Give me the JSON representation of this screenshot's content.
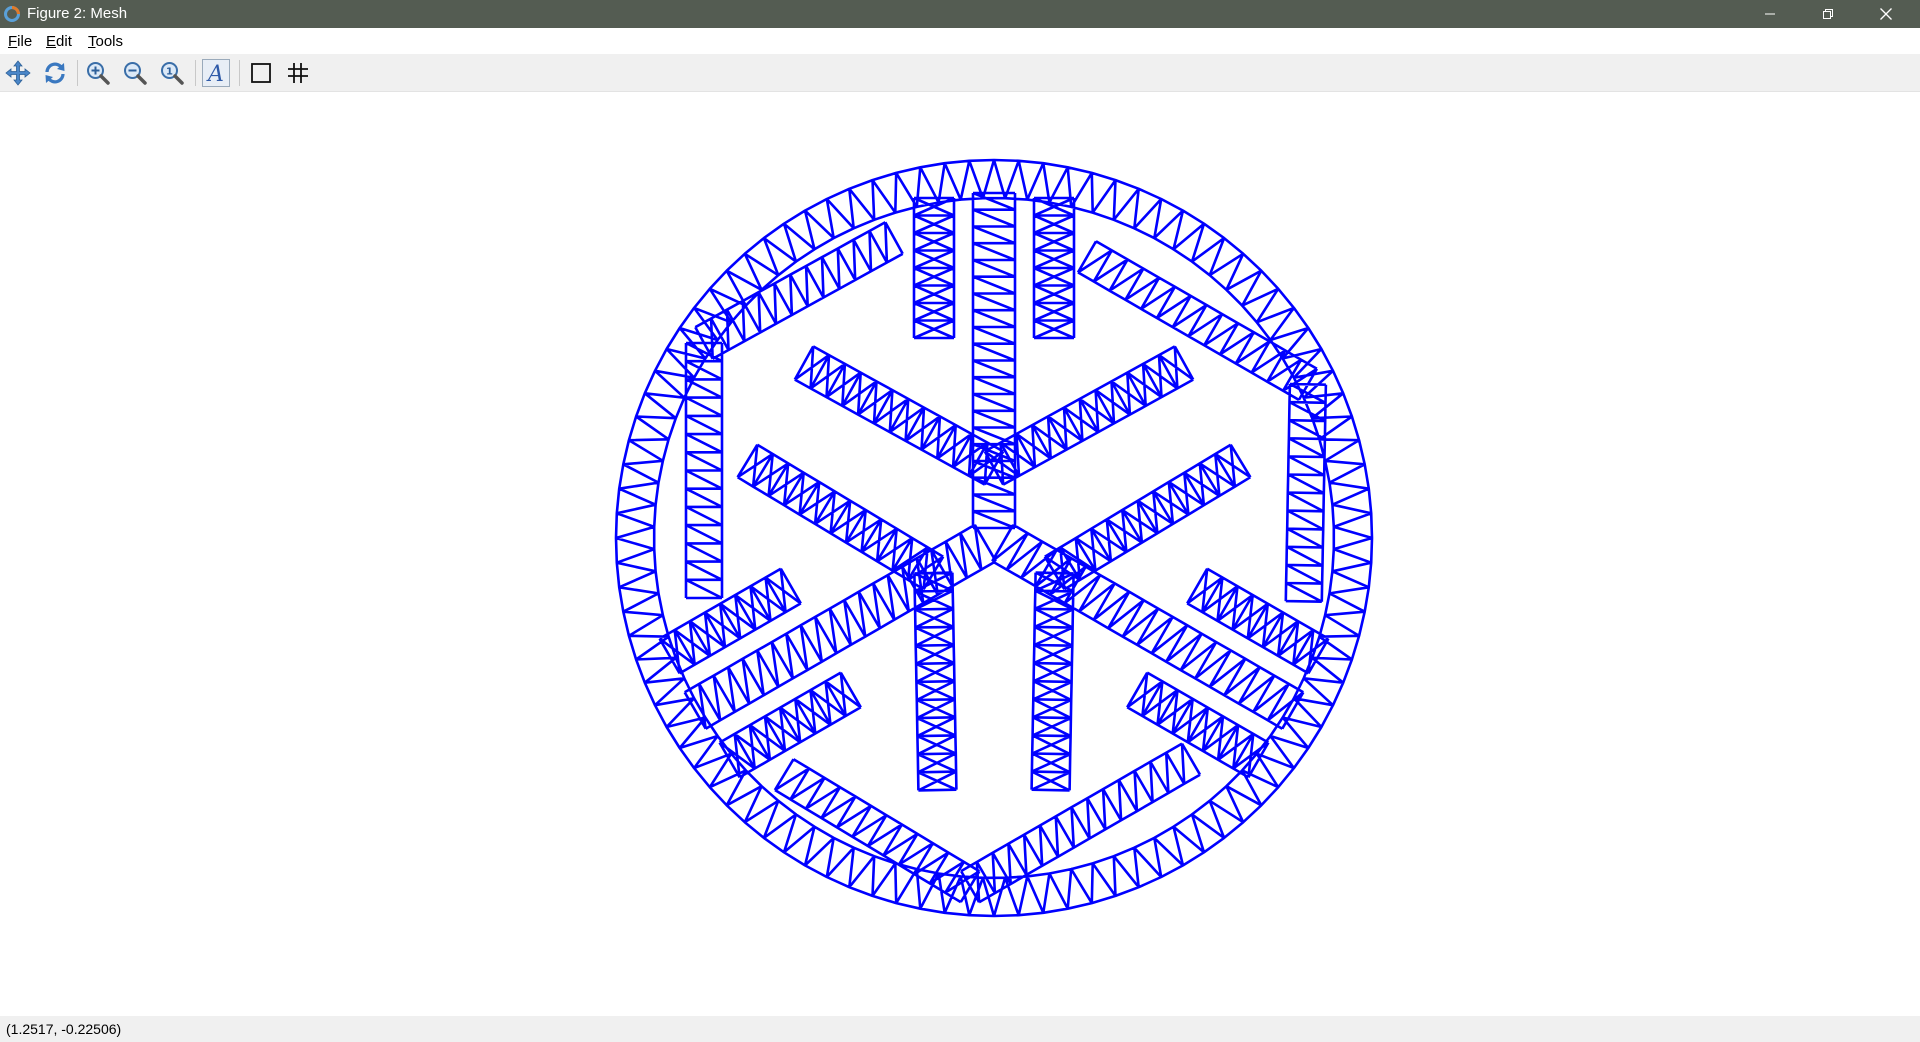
{
  "window": {
    "title": "Figure 2: Mesh"
  },
  "menu": {
    "file": {
      "mnemonic": "F",
      "rest": "ile"
    },
    "edit": {
      "mnemonic": "E",
      "rest": "dit"
    },
    "tools": {
      "mnemonic": "T",
      "rest": "ools"
    }
  },
  "toolbar": {
    "buttons": [
      "pan-icon",
      "rotate-icon",
      "zoom-in-icon",
      "zoom-out-icon",
      "zoom-reset-icon",
      "text-icon",
      "axes-box-icon",
      "grid-icon"
    ]
  },
  "status": {
    "coordinates": "(1.2517, -0.22506)"
  },
  "plot": {
    "mesh_color": "#0000ff",
    "background": "#ffffff"
  }
}
